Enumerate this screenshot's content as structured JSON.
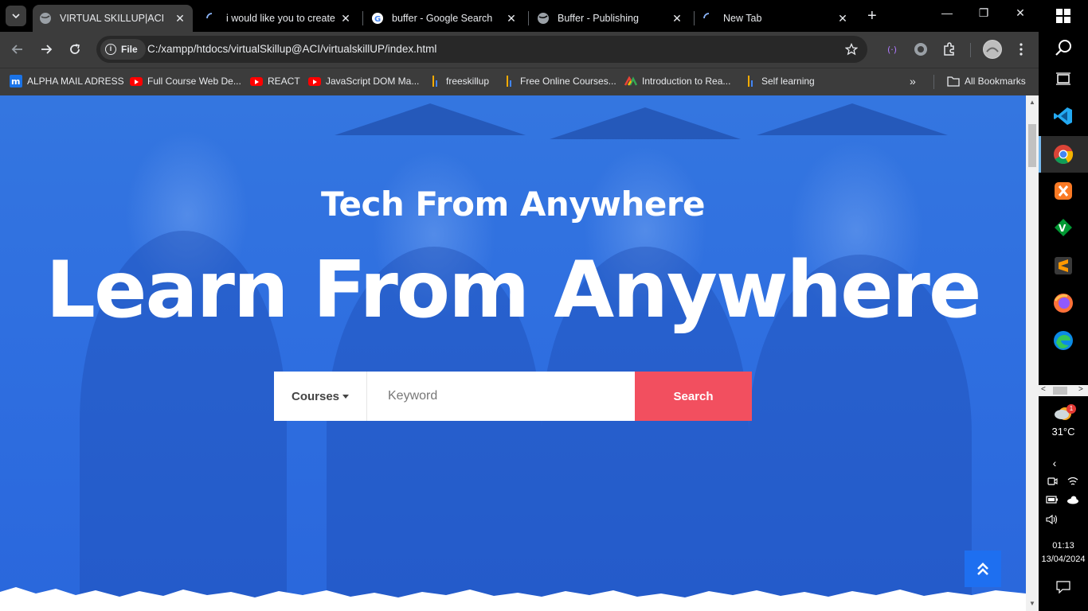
{
  "browser": {
    "tabs": [
      {
        "title": "VIRTUAL SKILLUP|ACI",
        "active": true,
        "favicon": "globe-icon"
      },
      {
        "title": "i would like you to create",
        "active": false,
        "favicon": "loading-spinner-icon"
      },
      {
        "title": "buffer - Google Search",
        "active": false,
        "favicon": "google-icon"
      },
      {
        "title": "Buffer - Publishing",
        "active": false,
        "favicon": "globe-icon"
      },
      {
        "title": "New Tab",
        "active": false,
        "favicon": "loading-spinner-icon"
      }
    ],
    "toolbar": {
      "chip_label": "File",
      "url": "C:/xampp/htdocs/virtualSkillup@ACI/virtualskillUP/index.html"
    },
    "bookmarks": [
      {
        "label": "ALPHA MAIL ADRESS",
        "icon": "m-logo-icon"
      },
      {
        "label": "Full Course Web De...",
        "icon": "youtube-icon"
      },
      {
        "label": "REACT",
        "icon": "youtube-icon"
      },
      {
        "label": "JavaScript DOM Ma...",
        "icon": "youtube-icon"
      },
      {
        "label": "freeskillup",
        "icon": "bars-icon"
      },
      {
        "label": "Free Online Courses...",
        "icon": "bars-icon"
      },
      {
        "label": "Introduction to Rea...",
        "icon": "colorful-logo-icon"
      },
      {
        "label": "Self learning",
        "icon": "bars-icon"
      }
    ],
    "all_bookmarks_label": "All Bookmarks"
  },
  "page": {
    "hero_subtitle": "Tech From Anywhere",
    "hero_title": "Learn From Anywhere",
    "search": {
      "category_label": "Courses",
      "keyword_placeholder": "Keyword",
      "button_label": "Search"
    },
    "colors": {
      "hero_blue": "#2f6fe0",
      "search_button": "#f24f5f",
      "back_to_top": "#1e6ff0"
    }
  },
  "taskbar": {
    "apps": [
      "windows-start-icon",
      "search-icon",
      "task-view-icon",
      "vscode-icon",
      "chrome-icon",
      "xampp-icon",
      "vim-icon",
      "sublime-text-icon",
      "firefox-icon",
      "edge-icon"
    ],
    "weather": {
      "temp": "31°C",
      "badge": "1"
    },
    "clock": {
      "time": "01:13",
      "date": "13/04/2024"
    }
  }
}
